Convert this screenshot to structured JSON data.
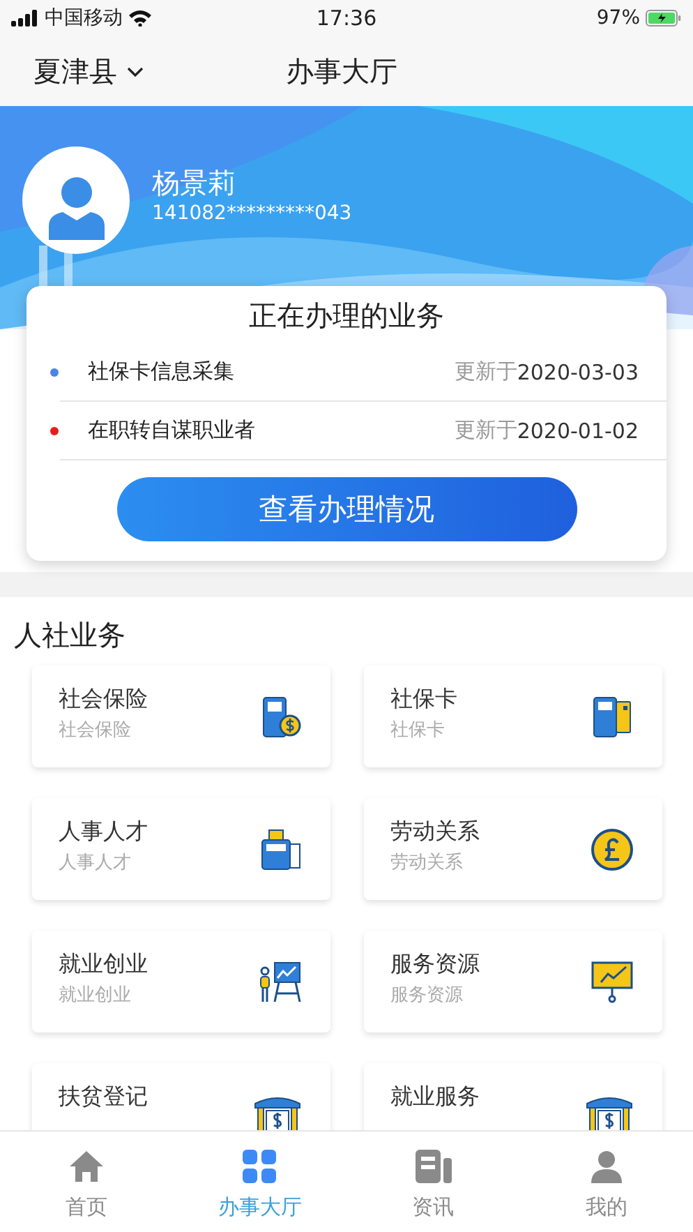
{
  "status_bar": {
    "carrier": "中国移动",
    "time": "17:36",
    "battery": "97%"
  },
  "nav": {
    "location": "夏津县",
    "title": "办事大厅"
  },
  "profile": {
    "name": "杨景莉",
    "id_number": "141082*********043"
  },
  "in_progress": {
    "title": "正在办理的业务",
    "items": [
      {
        "name": "社保卡信息采集",
        "updated_label": "更新于",
        "date": "2020-03-03",
        "color": "#4a86e8"
      },
      {
        "name": "在职转自谋职业者",
        "updated_label": "更新于",
        "date": "2020-01-02",
        "color": "#e81c1c"
      }
    ],
    "button": "查看办理情况"
  },
  "section_title": "人社业务",
  "services": [
    {
      "title": "社会保险",
      "subtitle": "社会保险"
    },
    {
      "title": "社保卡",
      "subtitle": "社保卡"
    },
    {
      "title": "人事人才",
      "subtitle": "人事人才"
    },
    {
      "title": "劳动关系",
      "subtitle": "劳动关系"
    },
    {
      "title": "就业创业",
      "subtitle": "就业创业"
    },
    {
      "title": "服务资源",
      "subtitle": "服务资源"
    },
    {
      "title": "扶贫登记"
    },
    {
      "title": "就业服务"
    }
  ],
  "tab_bar": [
    {
      "label": "首页",
      "selected": false
    },
    {
      "label": "办事大厅",
      "selected": true
    },
    {
      "label": "资讯",
      "selected": false
    },
    {
      "label": "我的",
      "selected": false
    }
  ]
}
